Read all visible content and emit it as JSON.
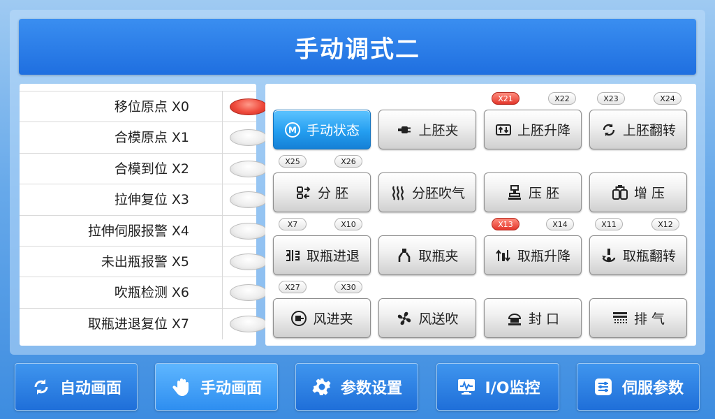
{
  "title": "手动调式二",
  "inputs": [
    {
      "label": "移位原点  X0",
      "on": true
    },
    {
      "label": "合模原点  X1",
      "on": false
    },
    {
      "label": "合模到位  X2",
      "on": false
    },
    {
      "label": "拉伸复位  X3",
      "on": false
    },
    {
      "label": "拉伸伺服报警  X4",
      "on": false
    },
    {
      "label": "未出瓶报警  X5",
      "on": false
    },
    {
      "label": "吹瓶检测  X6",
      "on": false
    },
    {
      "label": "取瓶进退复位  X7",
      "on": false
    }
  ],
  "buttons": [
    {
      "label": "手动状态",
      "icon": "motor-m-icon",
      "active": true
    },
    {
      "label": "上胚夹",
      "icon": "plug-clamp-icon"
    },
    {
      "label": "上胚升降",
      "icon": "lift-up-down-icon"
    },
    {
      "label": "上胚翻转",
      "icon": "rotate-icon"
    },
    {
      "label": "分  胚",
      "icon": "split-icon"
    },
    {
      "label": "分胚吹气",
      "icon": "heat-waves-icon"
    },
    {
      "label": "压  胚",
      "icon": "press-icon"
    },
    {
      "label": "增  压",
      "icon": "boost-icon"
    },
    {
      "label": "取瓶进退",
      "icon": "forward-back-icon"
    },
    {
      "label": "取瓶夹",
      "icon": "gripper-icon"
    },
    {
      "label": "取瓶升降",
      "icon": "bottle-lift-icon"
    },
    {
      "label": "取瓶翻转",
      "icon": "flip-icon"
    },
    {
      "label": "风进夹",
      "icon": "air-in-icon"
    },
    {
      "label": "风送吹",
      "icon": "fan-icon"
    },
    {
      "label": "封  口",
      "icon": "seal-icon"
    },
    {
      "label": "排  气",
      "icon": "exhaust-icon"
    }
  ],
  "indicators": [
    {
      "label": "X21",
      "on": true
    },
    {
      "label": "X22",
      "on": false
    },
    {
      "label": "X23",
      "on": false
    },
    {
      "label": "X24",
      "on": false
    },
    {
      "label": "X25",
      "on": false
    },
    {
      "label": "X26",
      "on": false
    },
    {
      "label": "X7",
      "on": false
    },
    {
      "label": "X10",
      "on": false
    },
    {
      "label": "X13",
      "on": true
    },
    {
      "label": "X14",
      "on": false
    },
    {
      "label": "X11",
      "on": false
    },
    {
      "label": "X12",
      "on": false
    },
    {
      "label": "X27",
      "on": false
    },
    {
      "label": "X30",
      "on": false
    }
  ],
  "nav": [
    {
      "label": "自动画面",
      "icon": "cycle-icon"
    },
    {
      "label": "手动画面",
      "icon": "hand-icon",
      "active": true
    },
    {
      "label": "参数设置",
      "icon": "gear-icon"
    },
    {
      "label": "I/O监控",
      "icon": "monitor-icon"
    },
    {
      "label": "伺服参数",
      "icon": "sliders-icon"
    }
  ],
  "colors": {
    "accent": "#1f6fe0",
    "led_on": "#e3362b",
    "active_button": "#249ef0"
  }
}
